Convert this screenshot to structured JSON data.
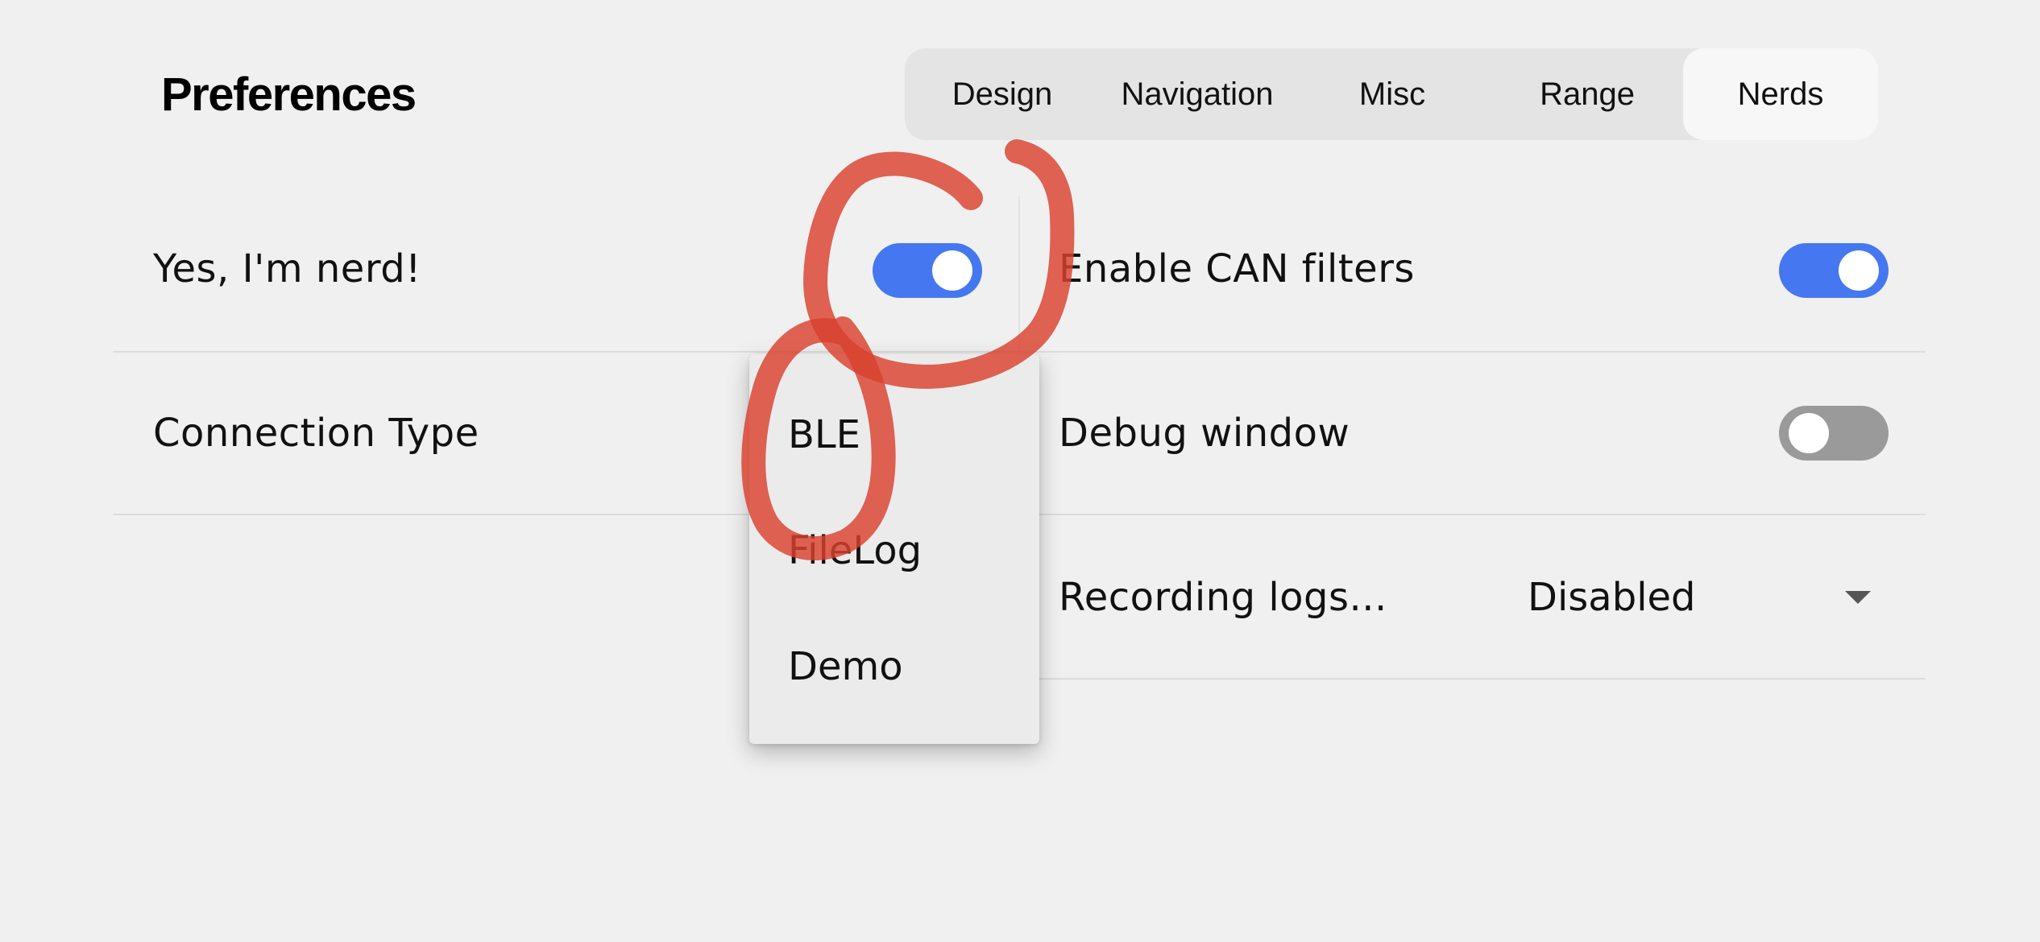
{
  "header": {
    "title": "Preferences"
  },
  "tabs": [
    {
      "label": "Design",
      "active": false
    },
    {
      "label": "Navigation",
      "active": false
    },
    {
      "label": "Misc",
      "active": false
    },
    {
      "label": "Range",
      "active": false
    },
    {
      "label": "Nerds",
      "active": true
    }
  ],
  "left_settings": {
    "nerd": {
      "label": "Yes, I'm nerd!",
      "on": true
    },
    "connection": {
      "label": "Connection Type"
    }
  },
  "right_settings": {
    "can_filters": {
      "label": "Enable CAN filters",
      "on": true
    },
    "debug_window": {
      "label": "Debug window",
      "on": false
    },
    "recording": {
      "label": "Recording logs...",
      "value": "Disabled"
    }
  },
  "dropdown": {
    "options": [
      "BLE",
      "FileLog",
      "Demo"
    ]
  },
  "colors": {
    "background": "#f0f0f0",
    "toggle_on": "#4578f0",
    "toggle_off": "#9a9a9a",
    "annotation": "#d9412e"
  }
}
